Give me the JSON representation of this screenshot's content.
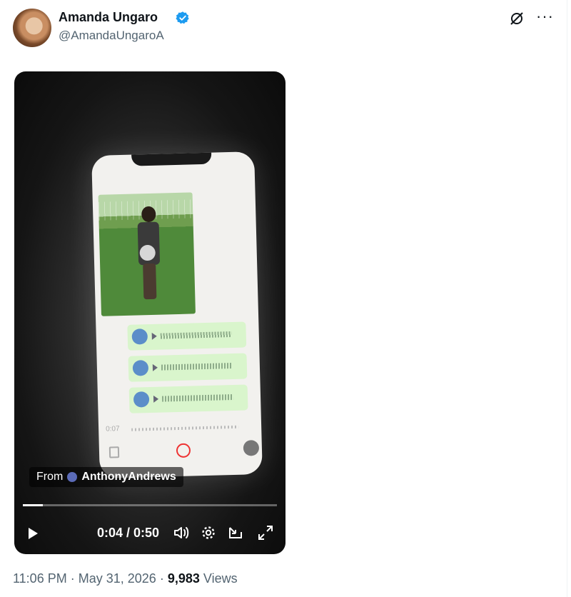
{
  "post": {
    "author_name": "Amanda Ungaro",
    "author_handle": "@AmandaUngaroA",
    "verified": true,
    "time": "11:06 PM",
    "date": "May 31, 2026",
    "separator": "·",
    "views_count": "9,983",
    "views_label": "Views"
  },
  "video": {
    "from_label": "From",
    "from_account": "AnthonyAndrews",
    "current_time": "0:04",
    "duration": "0:50",
    "time_display": "0:04 / 0:50",
    "progress_fraction": 0.08,
    "recording_time": "0:07"
  },
  "icons": {
    "header_right": [
      "grok-icon",
      "more-icon"
    ],
    "controls": [
      "play-icon",
      "volume-icon",
      "settings-icon",
      "pip-icon",
      "fullscreen-icon"
    ]
  },
  "colors": {
    "verified": "#1d9bf0",
    "secondary_text": "#536471",
    "primary_text": "#0f1419"
  }
}
